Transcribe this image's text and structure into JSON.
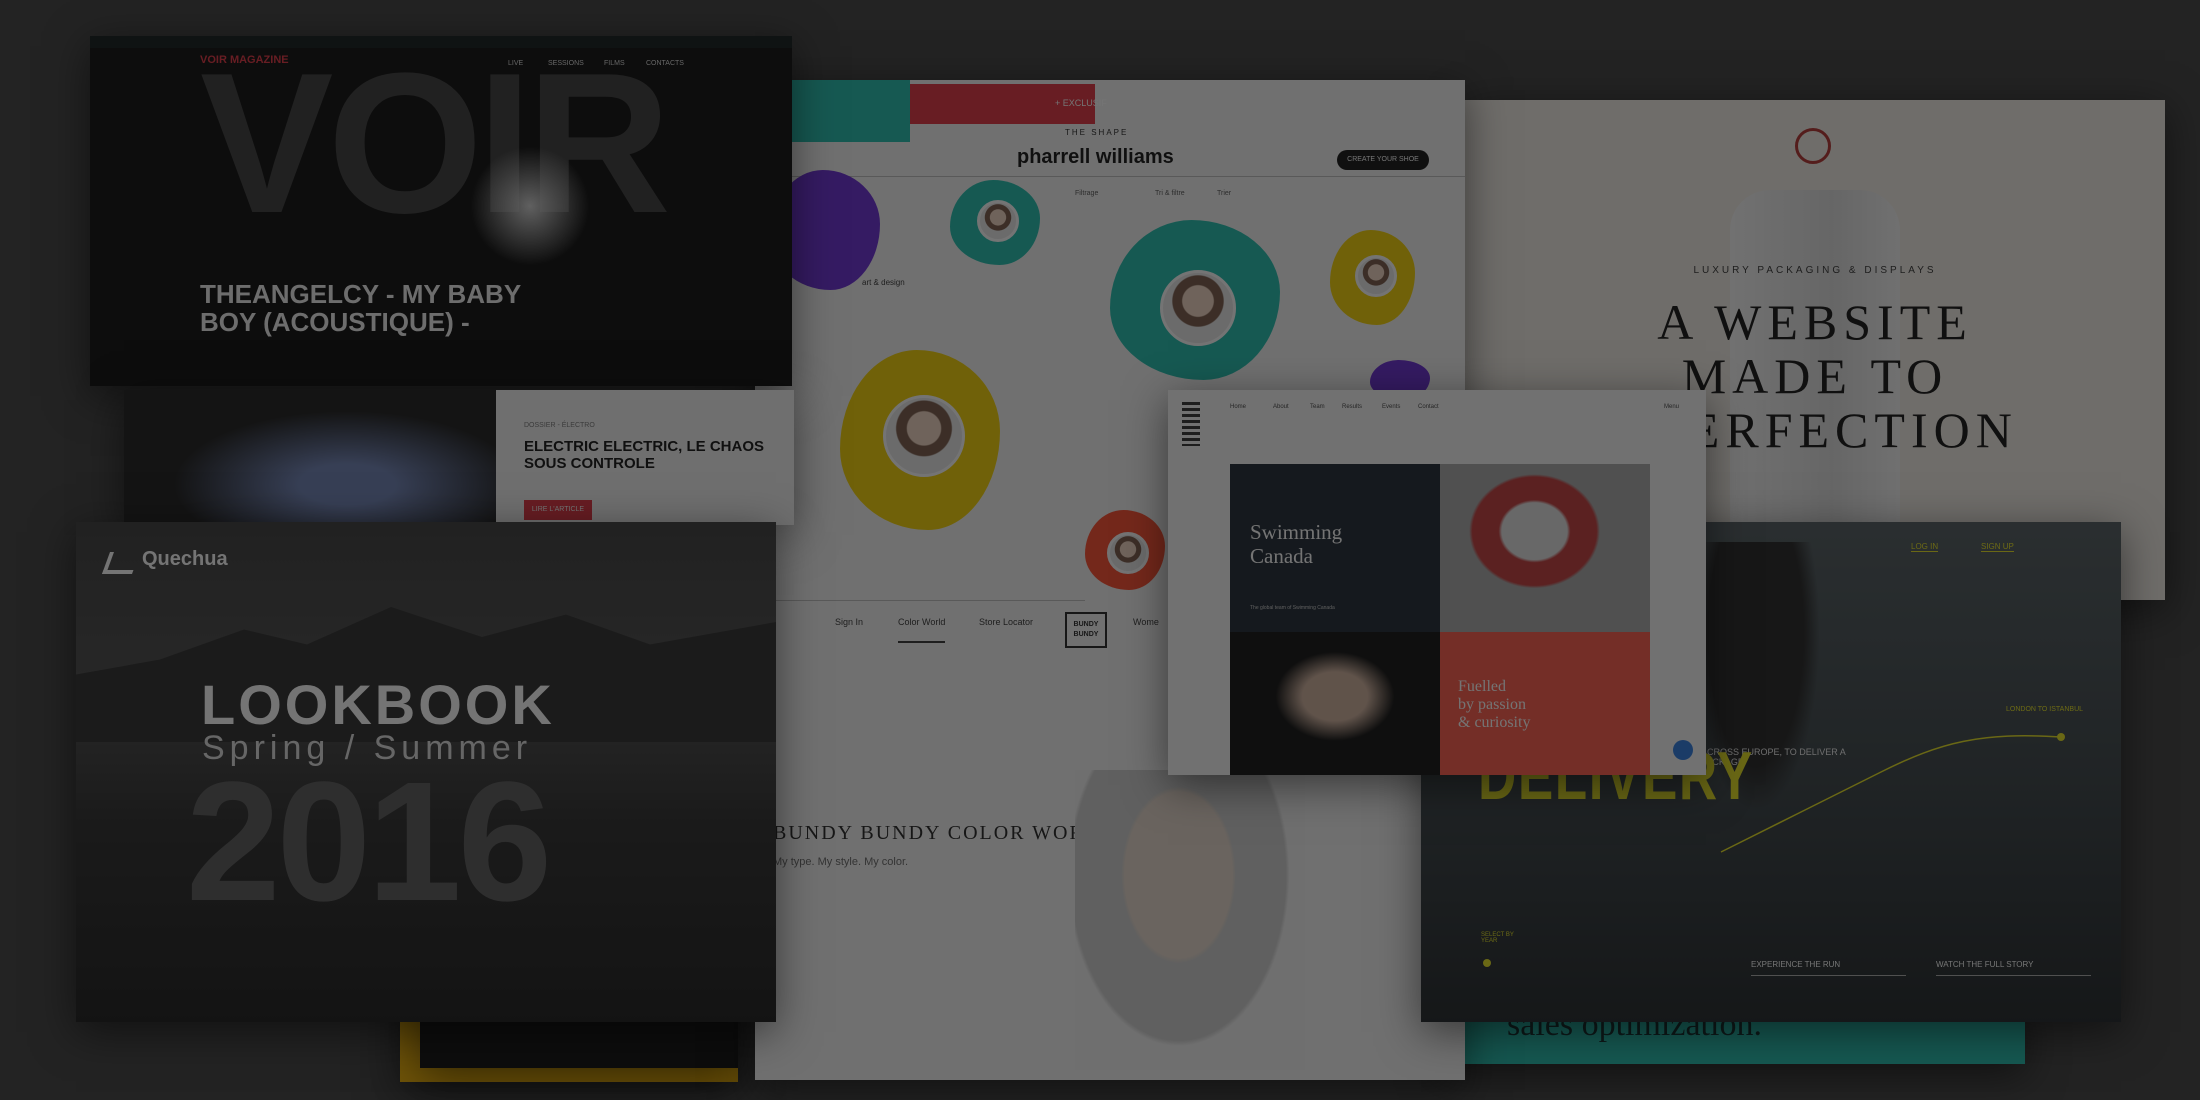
{
  "voir": {
    "brand": "VOIR MAGAZINE",
    "nav": [
      "LIVE",
      "SESSIONS",
      "FILMS",
      "CONTACTS"
    ],
    "bg_text": "VOIR",
    "headline": "THEANGELCY - MY BABY BOY (ACOUSTIQUE) -"
  },
  "electric": {
    "kicker": "DOSSIER - ÉLECTRO",
    "title": "ELECTRIC ELECTRIC, LE CHAOS SOUS CONTROLE",
    "cta": "LIRE L'ARTICLE"
  },
  "pharrell": {
    "banner": "+ EXCLUSIF",
    "kicker": "THE SHAPE",
    "title": "pharrell williams",
    "cta": "CREATE YOUR SHOE",
    "filter_left": "Filtrage",
    "filter_mid": "Tri & filtre",
    "filter_right": "Trier",
    "card_label": "art & design",
    "nav": [
      "Sign In",
      "Color World",
      "Store Locator"
    ],
    "nav_partial": "Wome",
    "brand_mark": "BUNDY BUNDY",
    "promo_title": "BUNDY BUNDY COLOR WORLD",
    "promo_sub": "My type. My style. My color."
  },
  "luxury": {
    "kicker": "LUXURY PACKAGING & DISPLAYS",
    "headline": "A WEBSITE MADE TO PERFECTION"
  },
  "swimming": {
    "nav": [
      "Home",
      "About",
      "Team",
      "Results",
      "Events",
      "Contact"
    ],
    "menu_right": "Menu",
    "title_line1": "Swimming",
    "title_line2": "Canada",
    "caption": "The global team of Swimming Canada",
    "red_line1": "Fuelled",
    "red_line2": "by passion",
    "red_line3": "& curiosity"
  },
  "quechua": {
    "brand": "Quechua",
    "title": "LOOKBOOK",
    "subtitle": "Spring / Summer",
    "year": "2016"
  },
  "delivery": {
    "nav": [
      "LOG IN",
      "SIGN UP"
    ],
    "headline": "DELIVERY",
    "route_label_1": "LONDON TO ISTANBUL",
    "route_label_2": "ACROSS EUROPE, TO DELIVER A PACKAGE",
    "bottom_left": "SELECT BY YEAR",
    "link1": "EXPERIENCE THE RUN",
    "link2": "WATCH THE FULL STORY",
    "accent": "#e6e21e"
  },
  "sales": {
    "text": "sales optimization."
  },
  "colors": {
    "background": "#232323",
    "teal": "#1fbfae",
    "red": "#e2313f",
    "yellow": "#f6d200",
    "purple": "#6a2bd6",
    "orange_red": "#ff4a2b",
    "quechua_accent": "#f2b400"
  }
}
